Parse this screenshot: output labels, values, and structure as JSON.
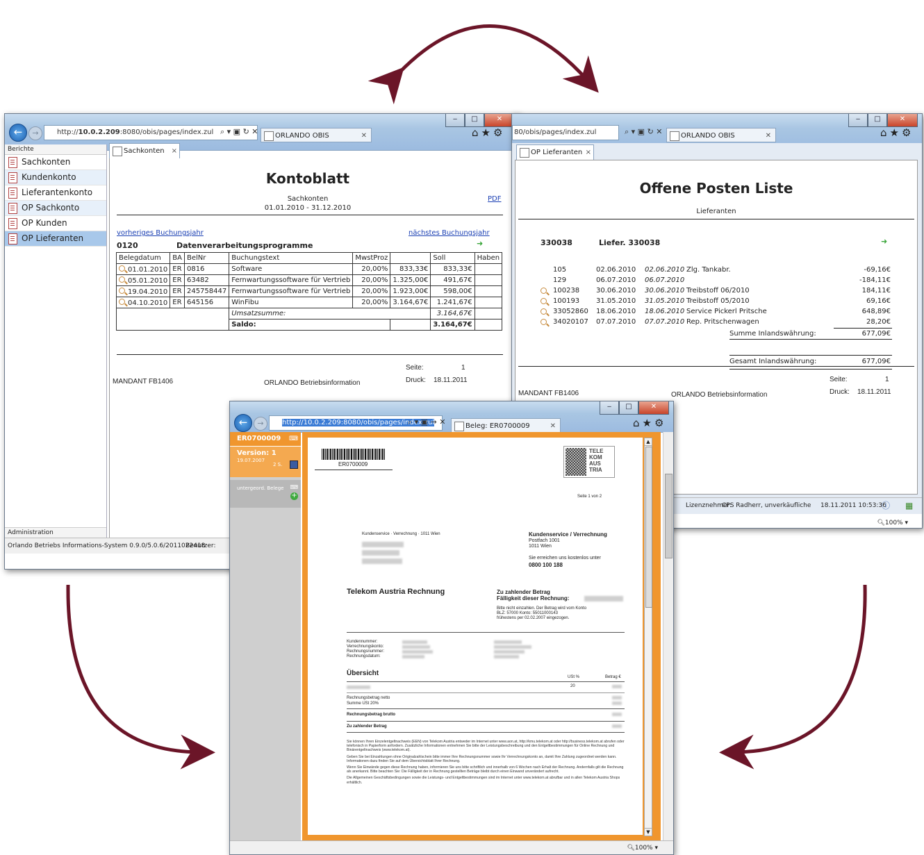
{
  "window1": {
    "url_prefix": "http://",
    "url_host": "10.0.2.209",
    "url_rest": ":8080/obis/pages/index.zul",
    "tab_label": "ORLANDO OBIS",
    "sidebar_header": "Berichte",
    "sidebar_items": [
      {
        "label": "Sachkonten"
      },
      {
        "label": "Kundenkonto"
      },
      {
        "label": "Lieferantenkonto"
      },
      {
        "label": "OP Sachkonto"
      },
      {
        "label": "OP Kunden"
      },
      {
        "label": "OP Lieferanten"
      }
    ],
    "sidebar_footer": "Administration",
    "doc_tab": "Sachkonten",
    "report": {
      "title": "Kontoblatt",
      "subtitle": "Sachkonten",
      "period": "01.01.2010 - 31.12.2010",
      "pdf": "PDF",
      "prev_year": "vorheriges Buchungsjahr",
      "next_year": "nächstes Buchungsjahr",
      "account_no": "0120",
      "account_name": "Datenverarbeitungsprogramme",
      "columns": [
        "Belegdatum",
        "BA",
        "BelNr",
        "Buchungstext",
        "MwstProz",
        "",
        "Soll",
        "Haben"
      ],
      "rows": [
        {
          "date": "01.01.2010",
          "ba": "ER",
          "nr": "0816",
          "text": "Software",
          "mwst": "20,00%",
          "netto": "833,33€",
          "soll": "833,33€",
          "haben": ""
        },
        {
          "date": "05.01.2010",
          "ba": "ER",
          "nr": "63482",
          "text": "Fernwartungssoftware für Vertrieb",
          "mwst": "20,00%",
          "netto": "1.325,00€",
          "soll": "491,67€",
          "haben": ""
        },
        {
          "date": "19.04.2010",
          "ba": "ER",
          "nr": "245758447",
          "text": "Fernwartungssoftware für Vertrieb",
          "mwst": "20,00%",
          "netto": "1.923,00€",
          "soll": "598,00€",
          "haben": ""
        },
        {
          "date": "04.10.2010",
          "ba": "ER",
          "nr": "645156",
          "text": "WinFibu",
          "mwst": "20,00%",
          "netto": "3.164,67€",
          "soll": "1.241,67€",
          "haben": ""
        }
      ],
      "umsatz_label": "Umsatzsumme:",
      "umsatz_value": "3.164,67€",
      "saldo_label": "Saldo:",
      "saldo_value": "3.164,67€",
      "seite_label": "Seite:",
      "seite_value": "1",
      "mandant": "MANDANT FB1406",
      "company": "ORLANDO Betriebsinformation",
      "druck_label": "Druck:",
      "druck_value": "18.11.2011"
    },
    "status": "Orlando Betriebs Informations-System 0.9.0/5.0.6/2011022418",
    "status_user": "Benutzer:"
  },
  "window2": {
    "url": "80/obis/pages/index.zul",
    "tab_label": "ORLANDO OBIS",
    "doc_tab": "OP Lieferanten",
    "report": {
      "title": "Offene Posten Liste",
      "subtitle": "Lieferanten",
      "supplier_no": "330038",
      "supplier_name": "Liefer. 330038",
      "rows": [
        {
          "nr": "105",
          "date1": "02.06.2010",
          "date2": "02.06.2010",
          "text": "Zlg. Tankabr.",
          "amount": "-69,16€",
          "icon": false
        },
        {
          "nr": "129",
          "date1": "06.07.2010",
          "date2": "06.07.2010",
          "text": "",
          "amount": "-184,11€",
          "icon": false
        },
        {
          "nr": "100238",
          "date1": "30.06.2010",
          "date2": "30.06.2010",
          "text": "Treibstoff 06/2010",
          "amount": "184,11€",
          "icon": true
        },
        {
          "nr": "100193",
          "date1": "31.05.2010",
          "date2": "31.05.2010",
          "text": "Treibstoff 05/2010",
          "amount": "69,16€",
          "icon": true
        },
        {
          "nr": "33052860",
          "date1": "18.06.2010",
          "date2": "18.06.2010",
          "text": "Service Pickerl Pritsche",
          "amount": "648,89€",
          "icon": true
        },
        {
          "nr": "34020107",
          "date1": "07.07.2010",
          "date2": "07.07.2010",
          "text": "Rep. Pritschenwagen",
          "amount": "28,20€",
          "icon": true
        }
      ],
      "summe_label": "Summe Inlandswährung:",
      "summe_value": "677,09€",
      "gesamt_label": "Gesamt Inlandswährung:",
      "gesamt_value": "677,09€",
      "seite_label": "Seite:",
      "seite_value": "1",
      "mandant": "MANDANT FB1406",
      "company": "ORLANDO Betriebsinformation",
      "druck_label": "Druck:",
      "druck_value": "18.11.2011"
    },
    "status_license_label": "Lizenznehmer:",
    "status_license": "CPS Radherr, unverkäufliche",
    "status_time": "18.11.2011 10:53:36",
    "zoom": "100%"
  },
  "window3": {
    "url": "http://10.0.2.209:8080/obis/pages/index.zul",
    "tab_label": "Beleg: ER0700009",
    "side_title": "ER0700009",
    "version": "Version: 1",
    "version_date": "19.07.2007",
    "version_pages": "2 S.",
    "subdocs": "untergeord. Belege",
    "zoom": "100%",
    "invoice": {
      "barcode_text": "ER0700009",
      "logo_lines": [
        "TELE",
        "KOM",
        "AUS",
        "TRIA"
      ],
      "page": "Seite 1 von 2",
      "sender": "Kundenservice · Verrechnung · 1011 Wien",
      "service_title": "Kundenservice / Verrechnung",
      "service_addr1": "Postfach 1001",
      "service_addr2": "1011 Wien",
      "reach": "Sie erreichen uns kostenlos unter",
      "phone": "0800 100 188",
      "heading": "Telekom Austria Rechnung",
      "amount_due": "Zu zahlender Betrag",
      "due_date": "Fälligkeit dieser Rechnung:",
      "note1": "Bitte nicht einzahlen. Der Betrag wird vom Konto",
      "note2": "BLZ: 57000 Konto: 55011000143",
      "note3": "frühestens per 02.02.2007 eingezogen.",
      "labels": [
        "Kundennummer:",
        "Verrechnungskonto:",
        "Rechnungsnummer:",
        "Rechnungsdatum:"
      ],
      "overview": "Übersicht",
      "ust": "USt %",
      "betrag": "Betrag €",
      "ust_value": "20",
      "netto": "Rechnungsbetrag netto",
      "sum_ust": "Summe USt 20%",
      "brutto": "Rechnungsbetrag brutto",
      "zahlen": "Zu zahlender Betrag",
      "para1": "Sie können Ihren Einzelentgeltnachweis (EEN) von Telekom Austria entweder im Internet unter www.aon.at, http://kmu.telekom.at oder http://business.telekom.at abrufen oder telefonisch in Papierform anfordern. Zusätzliche Informationen entnehmen Sie bitte der Leistungsbeschreibung und den Entgeltbestimmungen für Online Rechnung und Binärentgeltnachweis (www.telekom.at).",
      "para2": "Geben Sie bei Einzahlungen ohne Originalzahlschein bitte immer Ihre Rechnungsnummer sowie Ihr Verrechnungskonto an, damit Ihre Zahlung zugeordnet werden kann. Informationen dazu finden Sie auf dem Übersichtsblatt Ihrer Rechnung.",
      "para3": "Wenn Sie Einwände gegen diese Rechnung haben, informieren Sie uns bitte schriftlich und innerhalb von 6 Wochen nach Erhalt der Rechnung. Andernfalls gilt die Rechnung als anerkannt. Bitte beachten Sie: Die Fälligkeit der in Rechnung gestellten Beträge bleibt durch einen Einwand unverändert aufrecht.",
      "para4": "Die Allgemeinen Geschäftsbedingungen sowie die Leistungs- und Entgeltbestimmungen sind im Internet unter www.telekom.at abrufbar und in allen Telekom Austria Shops erhältlich."
    }
  },
  "colors": {
    "arrow": "#6b1528",
    "accent": "#f0962e",
    "sidebar_sel": "#a8c8ea"
  }
}
